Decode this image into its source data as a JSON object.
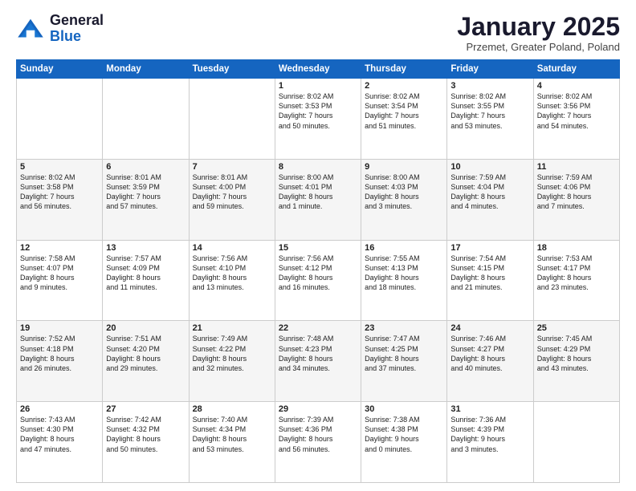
{
  "logo": {
    "line1": "General",
    "line2": "Blue"
  },
  "title": "January 2025",
  "subtitle": "Przemet, Greater Poland, Poland",
  "days_of_week": [
    "Sunday",
    "Monday",
    "Tuesday",
    "Wednesday",
    "Thursday",
    "Friday",
    "Saturday"
  ],
  "weeks": [
    [
      {
        "day": "",
        "info": ""
      },
      {
        "day": "",
        "info": ""
      },
      {
        "day": "",
        "info": ""
      },
      {
        "day": "1",
        "info": "Sunrise: 8:02 AM\nSunset: 3:53 PM\nDaylight: 7 hours\nand 50 minutes."
      },
      {
        "day": "2",
        "info": "Sunrise: 8:02 AM\nSunset: 3:54 PM\nDaylight: 7 hours\nand 51 minutes."
      },
      {
        "day": "3",
        "info": "Sunrise: 8:02 AM\nSunset: 3:55 PM\nDaylight: 7 hours\nand 53 minutes."
      },
      {
        "day": "4",
        "info": "Sunrise: 8:02 AM\nSunset: 3:56 PM\nDaylight: 7 hours\nand 54 minutes."
      }
    ],
    [
      {
        "day": "5",
        "info": "Sunrise: 8:02 AM\nSunset: 3:58 PM\nDaylight: 7 hours\nand 56 minutes."
      },
      {
        "day": "6",
        "info": "Sunrise: 8:01 AM\nSunset: 3:59 PM\nDaylight: 7 hours\nand 57 minutes."
      },
      {
        "day": "7",
        "info": "Sunrise: 8:01 AM\nSunset: 4:00 PM\nDaylight: 7 hours\nand 59 minutes."
      },
      {
        "day": "8",
        "info": "Sunrise: 8:00 AM\nSunset: 4:01 PM\nDaylight: 8 hours\nand 1 minute."
      },
      {
        "day": "9",
        "info": "Sunrise: 8:00 AM\nSunset: 4:03 PM\nDaylight: 8 hours\nand 3 minutes."
      },
      {
        "day": "10",
        "info": "Sunrise: 7:59 AM\nSunset: 4:04 PM\nDaylight: 8 hours\nand 4 minutes."
      },
      {
        "day": "11",
        "info": "Sunrise: 7:59 AM\nSunset: 4:06 PM\nDaylight: 8 hours\nand 7 minutes."
      }
    ],
    [
      {
        "day": "12",
        "info": "Sunrise: 7:58 AM\nSunset: 4:07 PM\nDaylight: 8 hours\nand 9 minutes."
      },
      {
        "day": "13",
        "info": "Sunrise: 7:57 AM\nSunset: 4:09 PM\nDaylight: 8 hours\nand 11 minutes."
      },
      {
        "day": "14",
        "info": "Sunrise: 7:56 AM\nSunset: 4:10 PM\nDaylight: 8 hours\nand 13 minutes."
      },
      {
        "day": "15",
        "info": "Sunrise: 7:56 AM\nSunset: 4:12 PM\nDaylight: 8 hours\nand 16 minutes."
      },
      {
        "day": "16",
        "info": "Sunrise: 7:55 AM\nSunset: 4:13 PM\nDaylight: 8 hours\nand 18 minutes."
      },
      {
        "day": "17",
        "info": "Sunrise: 7:54 AM\nSunset: 4:15 PM\nDaylight: 8 hours\nand 21 minutes."
      },
      {
        "day": "18",
        "info": "Sunrise: 7:53 AM\nSunset: 4:17 PM\nDaylight: 8 hours\nand 23 minutes."
      }
    ],
    [
      {
        "day": "19",
        "info": "Sunrise: 7:52 AM\nSunset: 4:18 PM\nDaylight: 8 hours\nand 26 minutes."
      },
      {
        "day": "20",
        "info": "Sunrise: 7:51 AM\nSunset: 4:20 PM\nDaylight: 8 hours\nand 29 minutes."
      },
      {
        "day": "21",
        "info": "Sunrise: 7:49 AM\nSunset: 4:22 PM\nDaylight: 8 hours\nand 32 minutes."
      },
      {
        "day": "22",
        "info": "Sunrise: 7:48 AM\nSunset: 4:23 PM\nDaylight: 8 hours\nand 34 minutes."
      },
      {
        "day": "23",
        "info": "Sunrise: 7:47 AM\nSunset: 4:25 PM\nDaylight: 8 hours\nand 37 minutes."
      },
      {
        "day": "24",
        "info": "Sunrise: 7:46 AM\nSunset: 4:27 PM\nDaylight: 8 hours\nand 40 minutes."
      },
      {
        "day": "25",
        "info": "Sunrise: 7:45 AM\nSunset: 4:29 PM\nDaylight: 8 hours\nand 43 minutes."
      }
    ],
    [
      {
        "day": "26",
        "info": "Sunrise: 7:43 AM\nSunset: 4:30 PM\nDaylight: 8 hours\nand 47 minutes."
      },
      {
        "day": "27",
        "info": "Sunrise: 7:42 AM\nSunset: 4:32 PM\nDaylight: 8 hours\nand 50 minutes."
      },
      {
        "day": "28",
        "info": "Sunrise: 7:40 AM\nSunset: 4:34 PM\nDaylight: 8 hours\nand 53 minutes."
      },
      {
        "day": "29",
        "info": "Sunrise: 7:39 AM\nSunset: 4:36 PM\nDaylight: 8 hours\nand 56 minutes."
      },
      {
        "day": "30",
        "info": "Sunrise: 7:38 AM\nSunset: 4:38 PM\nDaylight: 9 hours\nand 0 minutes."
      },
      {
        "day": "31",
        "info": "Sunrise: 7:36 AM\nSunset: 4:39 PM\nDaylight: 9 hours\nand 3 minutes."
      },
      {
        "day": "",
        "info": ""
      }
    ]
  ]
}
